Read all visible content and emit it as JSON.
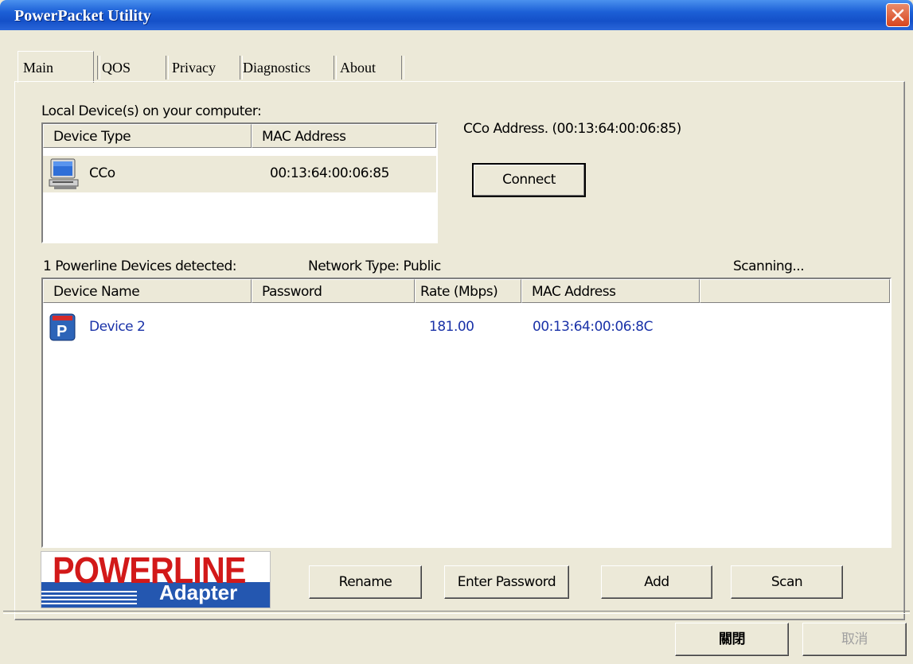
{
  "window": {
    "title": "PowerPacket Utility"
  },
  "tabs": [
    {
      "label": "Main"
    },
    {
      "label": "QOS"
    },
    {
      "label": "Privacy"
    },
    {
      "label": "Diagnostics"
    },
    {
      "label": "About"
    }
  ],
  "local": {
    "heading": "Local Device(s) on your computer:",
    "columns": [
      "Device Type",
      "MAC Address"
    ],
    "rows": [
      {
        "type": "CCo",
        "mac": "00:13:64:00:06:85",
        "icon": "computer-icon"
      }
    ]
  },
  "cco": {
    "address_text": "CCo Address. (00:13:64:00:06:85)",
    "connect_label": "Connect"
  },
  "status": {
    "detected": "1 Powerline Devices detected:",
    "network_type": "Network Type: Public",
    "scanning": "Scanning..."
  },
  "devices": {
    "columns": [
      "Device Name",
      "Password",
      "Rate (Mbps)",
      "MAC Address",
      ""
    ],
    "rows": [
      {
        "name": "Device 2",
        "password": "",
        "rate": "181.00",
        "mac": "00:13:64:00:06:8C",
        "icon": "powerline-device-icon"
      }
    ]
  },
  "logo": {
    "top": "POWERLINE",
    "bottom": "Adapter"
  },
  "buttons": {
    "rename": "Rename",
    "enter_password": "Enter Password",
    "add": "Add",
    "scan": "Scan",
    "close": "關閉",
    "cancel": "取消"
  },
  "colors": {
    "titlebar": "#1c5fd6",
    "device_text": "#1a32a8",
    "window_bg": "#ece9d8",
    "logo_red": "#d21919",
    "logo_blue": "#2457b0"
  }
}
